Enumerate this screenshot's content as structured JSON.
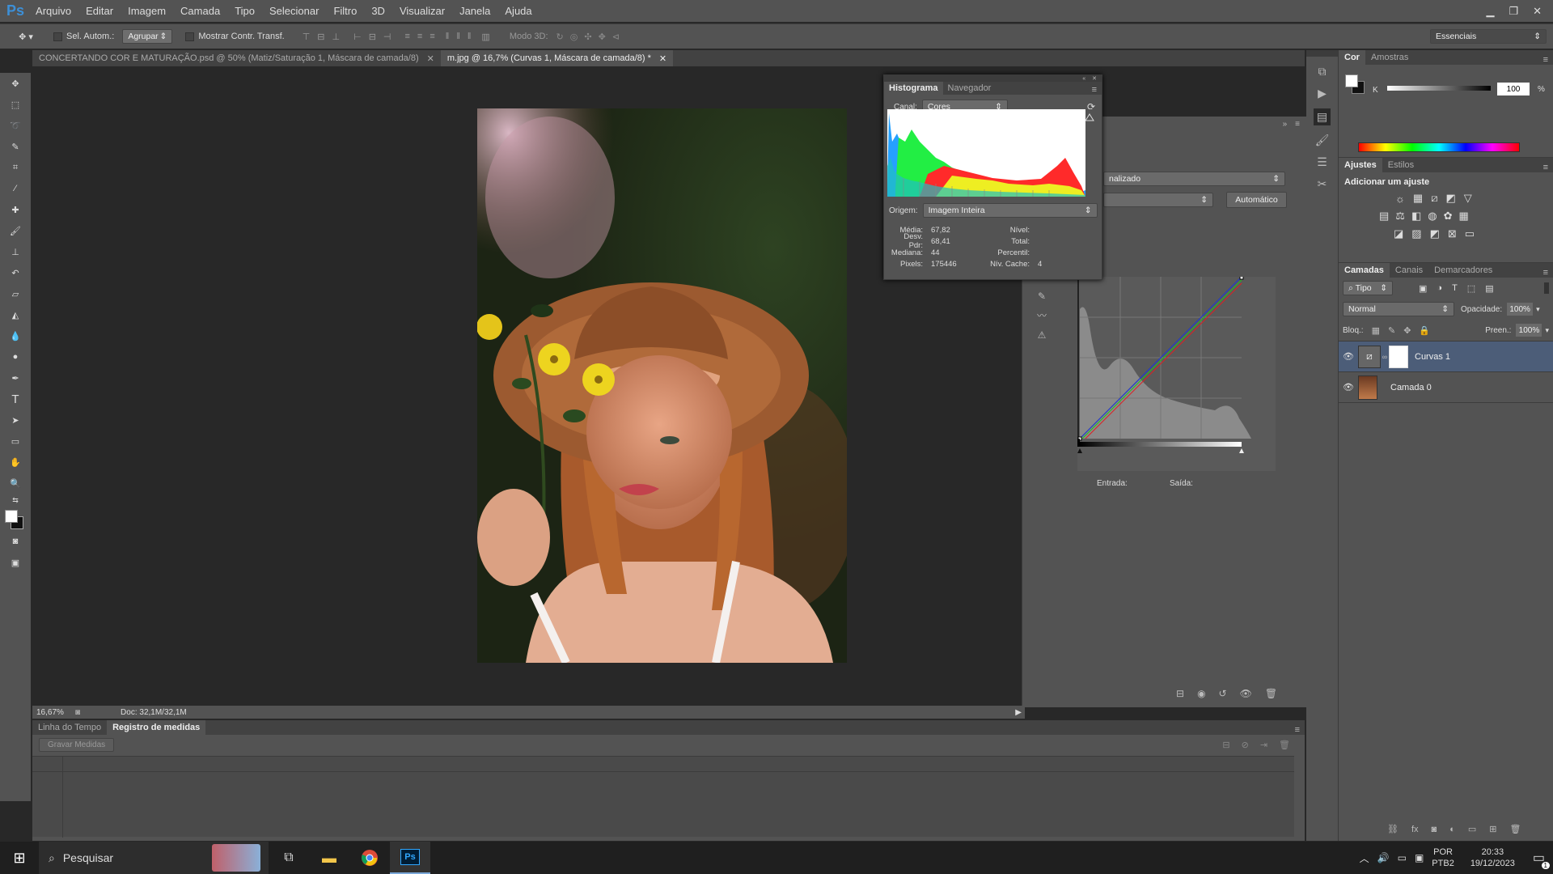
{
  "app": {
    "logo": "Ps"
  },
  "menu": [
    "Arquivo",
    "Editar",
    "Imagem",
    "Camada",
    "Tipo",
    "Selecionar",
    "Filtro",
    "3D",
    "Visualizar",
    "Janela",
    "Ajuda"
  ],
  "options": {
    "auto_select_label": "Sel. Autom.:",
    "auto_select_value": "Agrupar",
    "transform_label": "Mostrar Contr. Transf.",
    "mode3d_label": "Modo 3D:",
    "workspace": "Essenciais"
  },
  "doc_tabs": [
    {
      "label": "CONCERTANDO  COR E MATURAÇÃO.psd @ 50% (Matiz/Saturação 1, Máscara de camada/8)",
      "active": false
    },
    {
      "label": "m.jpg @ 16,7% (Curvas 1, Máscara de camada/8) *",
      "active": true
    }
  ],
  "histogram": {
    "tabs": [
      "Histograma",
      "Navegador"
    ],
    "channel_label": "Canal:",
    "channel_value": "Cores",
    "source_label": "Origem:",
    "source_value": "Imagem Inteira",
    "stats_left": [
      {
        "k": "Média:",
        "v": "67,82"
      },
      {
        "k": "Desv. Pdr:",
        "v": "68,41"
      },
      {
        "k": "Mediana:",
        "v": "44"
      },
      {
        "k": "Pixels:",
        "v": "175446"
      }
    ],
    "stats_right": [
      {
        "k": "Nível:",
        "v": ""
      },
      {
        "k": "Total:",
        "v": ""
      },
      {
        "k": "Percentil:",
        "v": ""
      },
      {
        "k": "Nív. Cache:",
        "v": "4"
      }
    ]
  },
  "curves": {
    "preset_value": "nalizado",
    "auto_button": "Automático",
    "input_label": "Entrada:",
    "output_label": "Saída:"
  },
  "status": {
    "zoom": "16,67%",
    "doc": "Doc: 32,1M/32,1M"
  },
  "bottom": {
    "tabs": [
      "Linha do Tempo",
      "Registro de medidas"
    ],
    "record_button": "Gravar Medidas"
  },
  "color_panel": {
    "tabs": [
      "Cor",
      "Amostras"
    ],
    "channel": "K",
    "value": "100",
    "unit": "%"
  },
  "adjust_panel": {
    "tabs": [
      "Ajustes",
      "Estilos"
    ],
    "title": "Adicionar um ajuste"
  },
  "layers_panel": {
    "tabs": [
      "Camadas",
      "Canais",
      "Demarcadores"
    ],
    "filter_value": "Tipo",
    "blend_mode": "Normal",
    "opacity_label": "Opacidade:",
    "opacity_value": "100%",
    "lock_label": "Bloq.:",
    "fill_label": "Preen.:",
    "fill_value": "100%",
    "layers": [
      {
        "name": "Curvas 1",
        "selected": true
      },
      {
        "name": "Camada 0",
        "selected": false
      }
    ]
  },
  "taskbar": {
    "search_placeholder": "Pesquisar",
    "lang1": "POR",
    "lang2": "PTB2",
    "time": "20:33",
    "date": "19/12/2023",
    "notif_count": "1"
  },
  "colors": {
    "accent_ps": "#3d8fd6",
    "selected_layer": "#4c5d78"
  }
}
